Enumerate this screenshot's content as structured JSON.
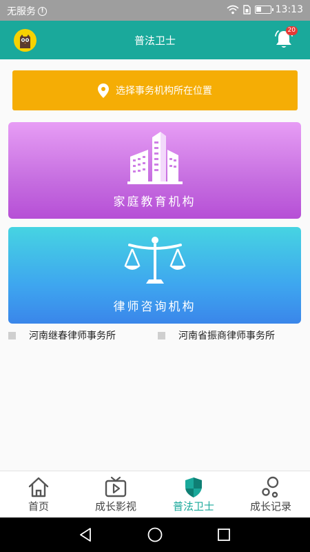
{
  "status_bar": {
    "carrier": "无服务",
    "time": "13:13",
    "battery_level": 0.4
  },
  "header": {
    "title": "普法卫士",
    "notification_count": "20"
  },
  "location": {
    "label": "选择事务机构所在位置",
    "icon": "map-pin-icon"
  },
  "cards": [
    {
      "label": "家庭教育机构",
      "icon": "building-icon",
      "color": "#c66ee0"
    },
    {
      "label": "律师咨询机构",
      "icon": "scales-icon",
      "color": "#3ea6ef"
    }
  ],
  "firms": [
    {
      "name": "河南继春律师事务所"
    },
    {
      "name": "河南省振商律师事务所"
    }
  ],
  "tabs": [
    {
      "label": "首页",
      "icon": "home-icon",
      "active": false
    },
    {
      "label": "成长影视",
      "icon": "tv-play-icon",
      "active": false
    },
    {
      "label": "普法卫士",
      "icon": "shield-icon",
      "active": true
    },
    {
      "label": "成长记录",
      "icon": "record-circles-icon",
      "active": false
    }
  ],
  "colors": {
    "primary": "#1aa99b",
    "location_button": "#f5ad05",
    "badge": "#e53935"
  }
}
